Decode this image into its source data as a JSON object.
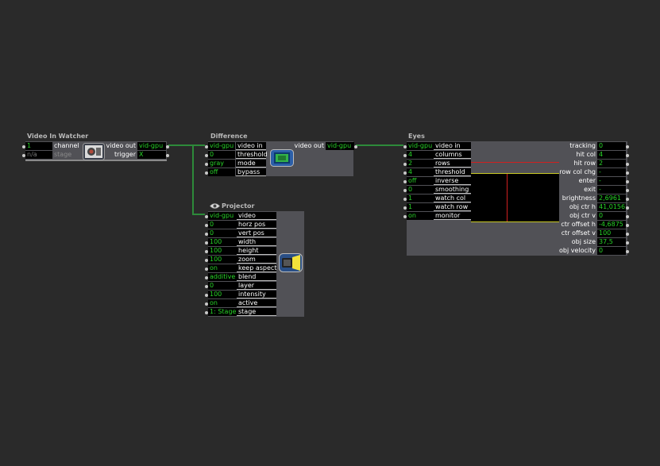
{
  "colors": {
    "canvas": "#2a2a2a",
    "actor_body": "#515156",
    "value_green": "#27d327",
    "wire_green": "#2d8a3a",
    "port_dot": "#c8c8c8"
  },
  "video_in_watcher": {
    "title": "Video In Watcher",
    "inputs": [
      {
        "value": "1",
        "label": "channel"
      },
      {
        "value": "n/a",
        "label": "stage"
      }
    ],
    "outputs": [
      {
        "label": "video out",
        "value": "vid-gpu"
      },
      {
        "label": "trigger",
        "value": "X"
      }
    ],
    "icon": "video-camera-icon"
  },
  "difference": {
    "title": "Difference",
    "inputs": [
      {
        "value": "vid-gpu",
        "label": "video in"
      },
      {
        "value": "0",
        "label": "threshold"
      },
      {
        "value": "gray",
        "label": "mode"
      },
      {
        "value": "off",
        "label": "bypass"
      }
    ],
    "outputs": [
      {
        "label": "video out",
        "value": "vid-gpu"
      }
    ],
    "icon": "monitor-icon"
  },
  "projector": {
    "title": "Projector",
    "title_icon": "eye-icon",
    "inputs": [
      {
        "value": "vid-gpu",
        "label": "video"
      },
      {
        "value": "0",
        "label": "horz pos"
      },
      {
        "value": "0",
        "label": "vert pos"
      },
      {
        "value": "100",
        "label": "width"
      },
      {
        "value": "100",
        "label": "height"
      },
      {
        "value": "100",
        "label": "zoom"
      },
      {
        "value": "on",
        "label": "keep aspect"
      },
      {
        "value": "additive",
        "label": "blend"
      },
      {
        "value": "0",
        "label": "layer"
      },
      {
        "value": "100",
        "label": "intensity"
      },
      {
        "value": "on",
        "label": "active"
      },
      {
        "value": "1: Stage",
        "label": "stage"
      }
    ],
    "icon": "projector-icon"
  },
  "eyes": {
    "title": "Eyes",
    "inputs": [
      {
        "value": "vid-gpu",
        "label": "video in"
      },
      {
        "value": "4",
        "label": "columns"
      },
      {
        "value": "2",
        "label": "rows"
      },
      {
        "value": "4",
        "label": "threshold"
      },
      {
        "value": "off",
        "label": "inverse"
      },
      {
        "value": "0",
        "label": "smoothing"
      },
      {
        "value": "1",
        "label": "watch col"
      },
      {
        "value": "1",
        "label": "watch row"
      },
      {
        "value": "on",
        "label": "monitor"
      }
    ],
    "outputs": [
      {
        "label": "tracking",
        "value": "0"
      },
      {
        "label": "hit col",
        "value": "4"
      },
      {
        "label": "hit row",
        "value": "2"
      },
      {
        "label": "row col chg",
        "value": "-"
      },
      {
        "label": "enter",
        "value": "-"
      },
      {
        "label": "exit",
        "value": "-"
      },
      {
        "label": "brightness",
        "value": "2,6961"
      },
      {
        "label": "obj ctr h",
        "value": "41,0156"
      },
      {
        "label": "obj ctr v",
        "value": "0"
      },
      {
        "label": "ctr offset h",
        "value": "-4,6875"
      },
      {
        "label": "ctr offset v",
        "value": "100"
      },
      {
        "label": "obj size",
        "value": "37,5"
      },
      {
        "label": "obj velocity",
        "value": "0"
      }
    ]
  }
}
